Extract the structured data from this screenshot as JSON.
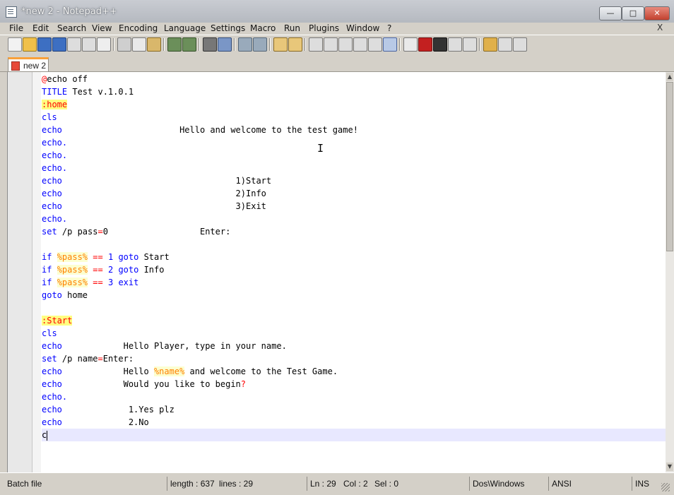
{
  "window": {
    "title": "*new 2 - Notepad++"
  },
  "menu": [
    "File",
    "Edit",
    "Search",
    "View",
    "Encoding",
    "Language",
    "Settings",
    "Macro",
    "Run",
    "Plugins",
    "Window",
    "?"
  ],
  "menu_close": "X",
  "tab": {
    "label": "new 2"
  },
  "code": [
    [
      [
        "at",
        "@"
      ],
      [
        "",
        "echo off"
      ]
    ],
    [
      [
        "kw",
        "TITLE"
      ],
      [
        "",
        " Test v.1.0.1"
      ]
    ],
    [
      [
        "label",
        ":home"
      ]
    ],
    [
      [
        "kw",
        "cls"
      ]
    ],
    [
      [
        "kw",
        "echo"
      ],
      [
        "",
        "                       Hello and welcome to the test game!"
      ]
    ],
    [
      [
        "kw",
        "echo."
      ]
    ],
    [
      [
        "kw",
        "echo."
      ]
    ],
    [
      [
        "kw",
        "echo."
      ]
    ],
    [
      [
        "kw",
        "echo"
      ],
      [
        "",
        "                                  1)Start"
      ]
    ],
    [
      [
        "kw",
        "echo"
      ],
      [
        "",
        "                                  2)Info"
      ]
    ],
    [
      [
        "kw",
        "echo"
      ],
      [
        "",
        "                                  3)Exit"
      ]
    ],
    [
      [
        "kw",
        "echo."
      ]
    ],
    [
      [
        "kw",
        "set"
      ],
      [
        "",
        " /p pass"
      ],
      [
        "op",
        "="
      ],
      [
        "",
        "0                  Enter:"
      ]
    ],
    [],
    [
      [
        "kw",
        "if"
      ],
      [
        "",
        " "
      ],
      [
        "var",
        "%pass%"
      ],
      [
        "",
        " "
      ],
      [
        "op",
        "=="
      ],
      [
        "",
        " "
      ],
      [
        "num",
        "1"
      ],
      [
        "",
        " "
      ],
      [
        "kw",
        "goto"
      ],
      [
        "",
        " Start"
      ]
    ],
    [
      [
        "kw",
        "if"
      ],
      [
        "",
        " "
      ],
      [
        "var",
        "%pass%"
      ],
      [
        "",
        " "
      ],
      [
        "op",
        "=="
      ],
      [
        "",
        " "
      ],
      [
        "num",
        "2"
      ],
      [
        "",
        " "
      ],
      [
        "kw",
        "goto"
      ],
      [
        "",
        " Info"
      ]
    ],
    [
      [
        "kw",
        "if"
      ],
      [
        "",
        " "
      ],
      [
        "var",
        "%pass%"
      ],
      [
        "",
        " "
      ],
      [
        "op",
        "=="
      ],
      [
        "",
        " "
      ],
      [
        "num",
        "3"
      ],
      [
        "",
        " "
      ],
      [
        "kw",
        "exit"
      ]
    ],
    [
      [
        "kw",
        "goto"
      ],
      [
        "",
        " home"
      ]
    ],
    [],
    [
      [
        "label",
        ":Start"
      ]
    ],
    [
      [
        "kw",
        "cls"
      ]
    ],
    [
      [
        "kw",
        "echo"
      ],
      [
        "",
        "            Hello Player, type in your name."
      ]
    ],
    [
      [
        "kw",
        "set"
      ],
      [
        "",
        " /p name"
      ],
      [
        "op",
        "="
      ],
      [
        "",
        "Enter:"
      ]
    ],
    [
      [
        "kw",
        "echo"
      ],
      [
        "",
        "            Hello "
      ],
      [
        "var",
        "%name%"
      ],
      [
        "",
        " and welcome to the Test Game."
      ]
    ],
    [
      [
        "kw",
        "echo"
      ],
      [
        "",
        "            Would you like to begin"
      ],
      [
        "op",
        "?"
      ]
    ],
    [
      [
        "kw",
        "echo."
      ]
    ],
    [
      [
        "kw",
        "echo"
      ],
      [
        "",
        "             1.Yes plz"
      ]
    ],
    [
      [
        "kw",
        "echo"
      ],
      [
        "",
        "             2.No"
      ]
    ],
    [
      [
        "",
        "c"
      ]
    ]
  ],
  "status": {
    "file_type": "Batch file",
    "length": "length : 637",
    "lines": "lines : 29",
    "ln": "Ln : 29",
    "col": "Col : 2",
    "sel": "Sel : 0",
    "eol": "Dos\\Windows",
    "encoding": "ANSI",
    "mode": "INS"
  },
  "colors": {
    "keyword": "#0000ff",
    "label_bg": "#ffff80",
    "variable": "#ff8000",
    "operator": "#ff0000",
    "caret_line": "#e8e8ff"
  }
}
